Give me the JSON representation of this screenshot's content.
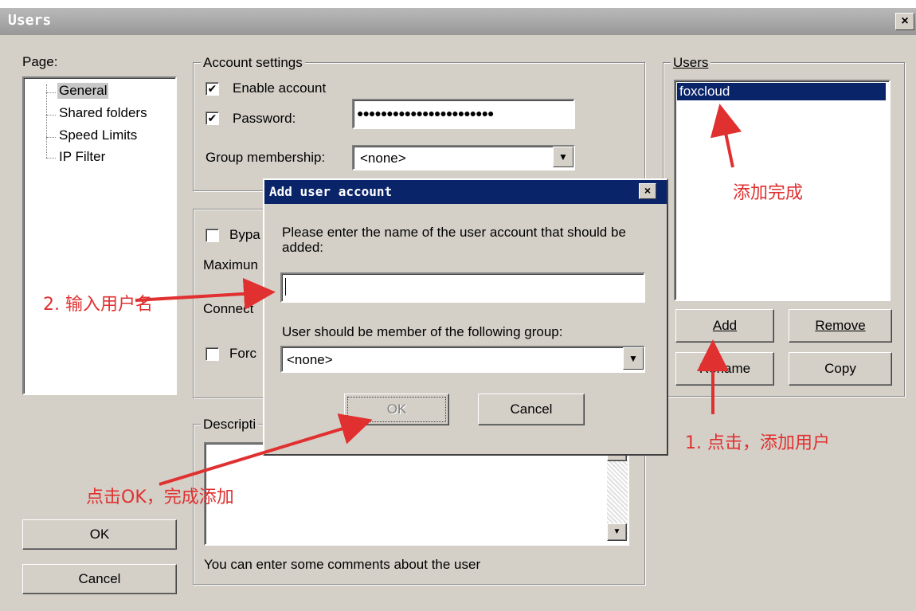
{
  "window": {
    "title": "Users",
    "close_glyph": "×"
  },
  "page_panel": {
    "label": "Page:",
    "items": [
      {
        "label": "General"
      },
      {
        "label": "Shared folders"
      },
      {
        "label": "Speed Limits"
      },
      {
        "label": "IP Filter"
      }
    ]
  },
  "account_settings": {
    "group_label": "Account settings",
    "enable_account": {
      "label": "Enable account",
      "checked": true
    },
    "password": {
      "label": "Password:",
      "checked": true,
      "value": "●●●●●●●●●●●●●●●●●●●●●●●"
    },
    "group_membership": {
      "label": "Group membership:",
      "value": "<none>"
    }
  },
  "other_settings": {
    "bypass_label": "Bypa",
    "maximum_label": "Maximun",
    "connect_label": "Connect",
    "force_label": "Forc"
  },
  "description": {
    "group_label": "Descripti",
    "hint": "You can enter some comments about the user"
  },
  "main_buttons": {
    "ok": "OK",
    "cancel": "Cancel"
  },
  "users_panel": {
    "group_label": "Users",
    "users": [
      {
        "name": "foxcloud",
        "selected": true
      }
    ],
    "buttons": {
      "add": "Add",
      "remove": "Remove",
      "rename": "Rename",
      "copy": "Copy"
    }
  },
  "dialog": {
    "title": "Add user account",
    "close_glyph": "×",
    "prompt": "Please enter the name of the user account that should be added:",
    "name_value": "",
    "group_prompt": "User should be member of the following group:",
    "group_value": "<none>",
    "ok": "OK",
    "cancel": "Cancel"
  },
  "annotations": {
    "done": "添加完成",
    "step1": "1. 点击，添加用户",
    "step2": "2. 输入用户名",
    "click_ok": "点击OK，完成添加"
  },
  "colors": {
    "annotation": "#e03030",
    "selection": "#0a246a",
    "dialog_title": "#0a246a"
  }
}
